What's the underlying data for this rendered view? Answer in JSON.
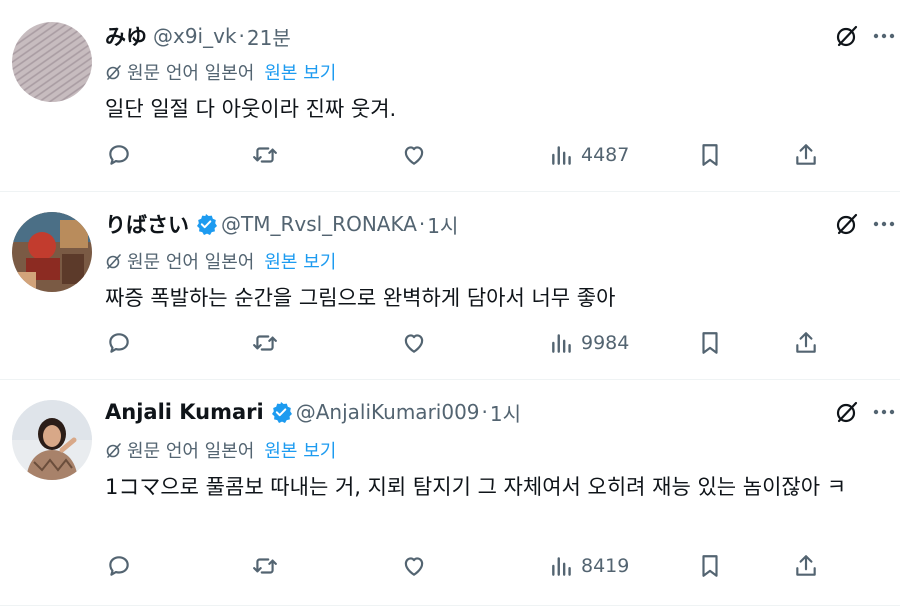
{
  "tweets": [
    {
      "name": "みゆ",
      "handle": "@x9i_vk",
      "separator": "·",
      "time": "21분",
      "verified": false,
      "translation": {
        "original_language": "원문 언어 일본어",
        "show_original": "원본 보기"
      },
      "text": "일단 일절 다 아웃이라 진짜 웃겨.",
      "views": "4487"
    },
    {
      "name": "りばさい",
      "handle": "@TM_Rvsl_RONAKA",
      "separator": "·",
      "time": "1시",
      "verified": true,
      "translation": {
        "original_language": "원문 언어 일본어",
        "show_original": "원본 보기"
      },
      "text": "짜증 폭발하는 순간을 그림으로 완벽하게 담아서 너무 좋아",
      "views": "9984"
    },
    {
      "name": "Anjali Kumari",
      "handle": "@AnjaliKumari009",
      "separator": "·",
      "time": "1시",
      "verified": true,
      "translation": {
        "original_language": "원문 언어 일본어",
        "show_original": "원본 보기"
      },
      "text": "1コマ으로 풀콤보 따내는 거, 지뢰 탐지기 그 자체여서 오히려 재능 있는 놈이잖아 ㅋ",
      "views": "8419"
    }
  ],
  "colors": {
    "text": "#0f1419",
    "secondary": "#536471",
    "link": "#1d9bf0",
    "verified": "#1d9bf0",
    "divider": "#eff3f4"
  },
  "icons": [
    "grok-icon",
    "more-icon",
    "translate-icon",
    "reply-icon",
    "retweet-icon",
    "like-icon",
    "views-icon",
    "bookmark-icon",
    "share-icon",
    "verified-icon"
  ]
}
